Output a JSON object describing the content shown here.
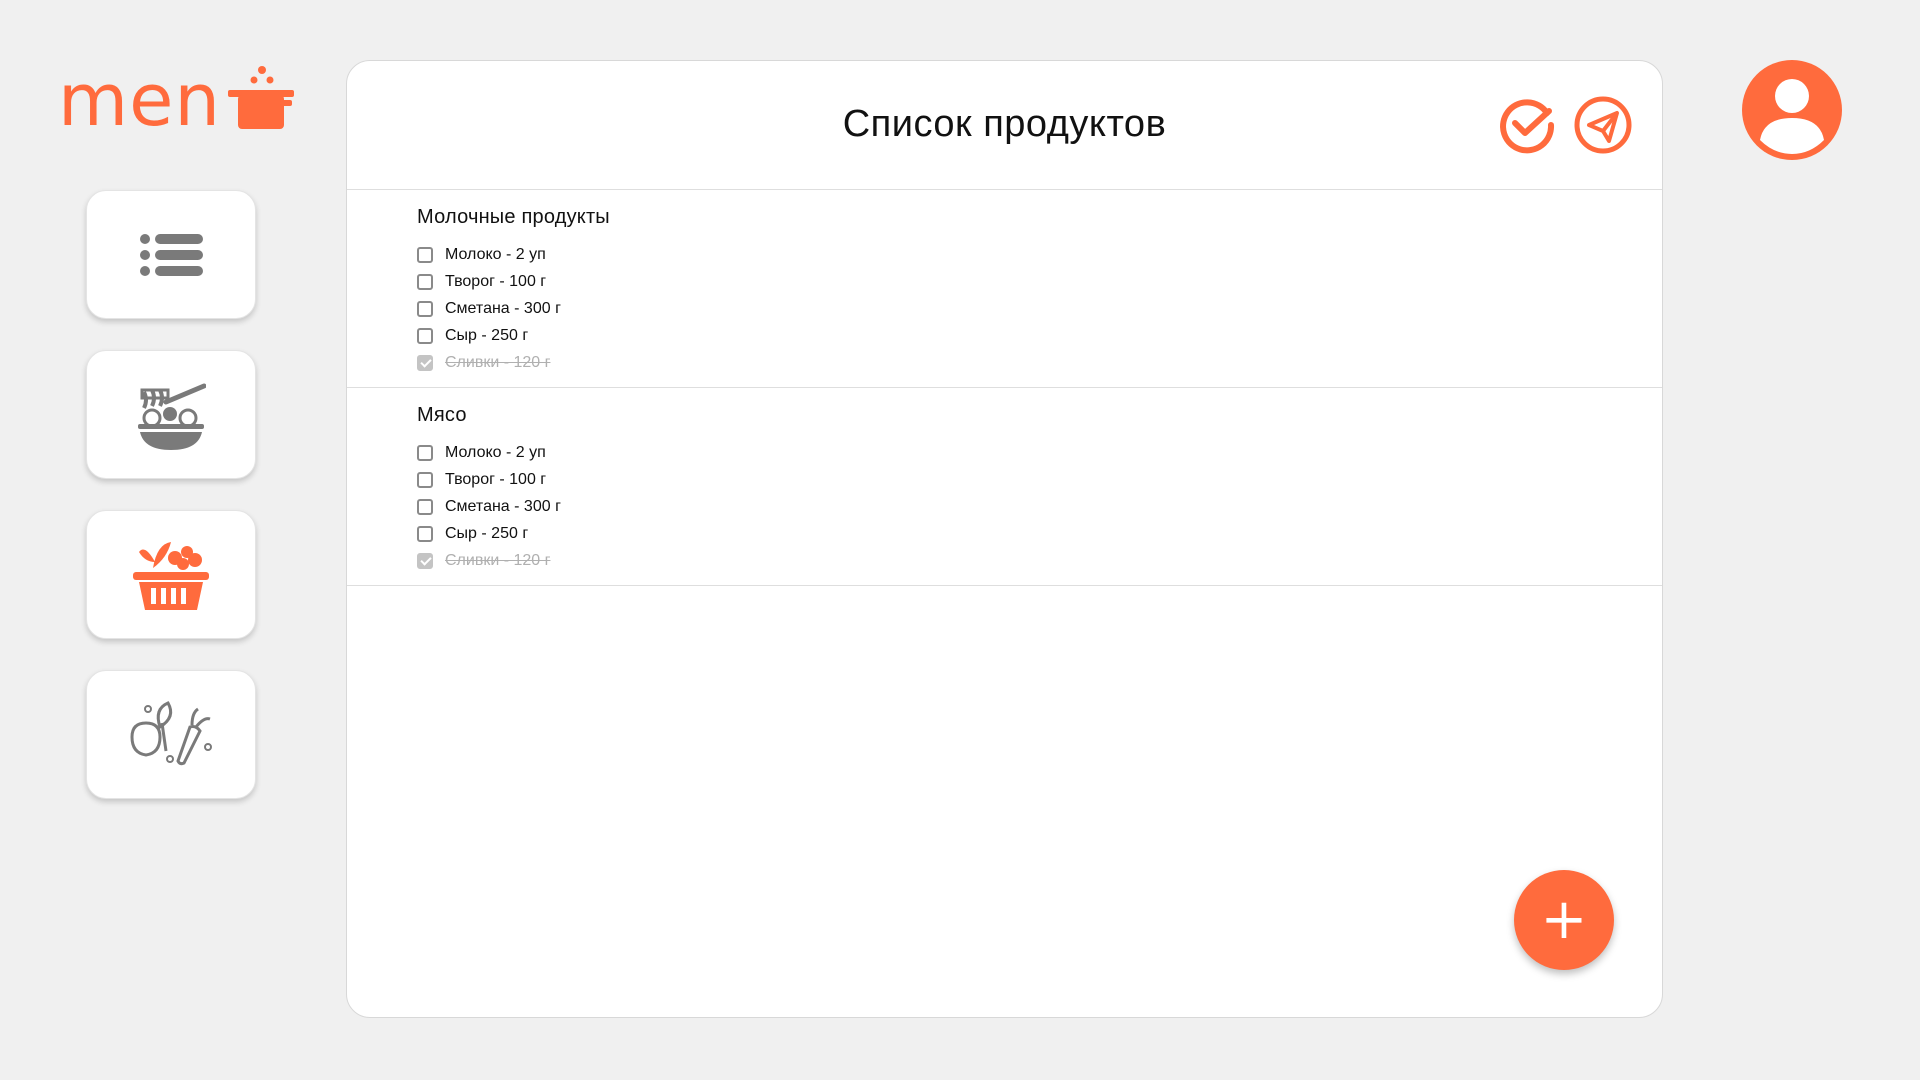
{
  "app": {
    "logo_text": "men",
    "accent_color": "#ff6b3d",
    "icon_color": "#7a7a7a"
  },
  "sidebar": {
    "items": [
      {
        "icon": "list-icon"
      },
      {
        "icon": "noodle-bowl-icon"
      },
      {
        "icon": "grocery-basket-icon"
      },
      {
        "icon": "vegetables-icon"
      }
    ]
  },
  "header": {
    "title": "Список продуктов",
    "actions": [
      {
        "icon": "check-circle-icon"
      },
      {
        "icon": "send-icon"
      }
    ]
  },
  "sections": [
    {
      "title": "Молочные продукты",
      "items": [
        {
          "label": "Молоко - 2 уп",
          "checked": false
        },
        {
          "label": "Творог - 100 г",
          "checked": false
        },
        {
          "label": "Сметана - 300 г",
          "checked": false
        },
        {
          "label": "Сыр - 250 г",
          "checked": false
        },
        {
          "label": "Сливки - 120 г",
          "checked": true
        }
      ]
    },
    {
      "title": "Мясо",
      "items": [
        {
          "label": "Молоко - 2 уп",
          "checked": false
        },
        {
          "label": "Творог - 100 г",
          "checked": false
        },
        {
          "label": "Сметана - 300 г",
          "checked": false
        },
        {
          "label": "Сыр - 250 г",
          "checked": false
        },
        {
          "label": "Сливки - 120 г",
          "checked": true
        }
      ]
    }
  ],
  "fab": {
    "label": "+",
    "icon": "plus-icon"
  },
  "user": {
    "icon": "user-avatar-icon"
  }
}
